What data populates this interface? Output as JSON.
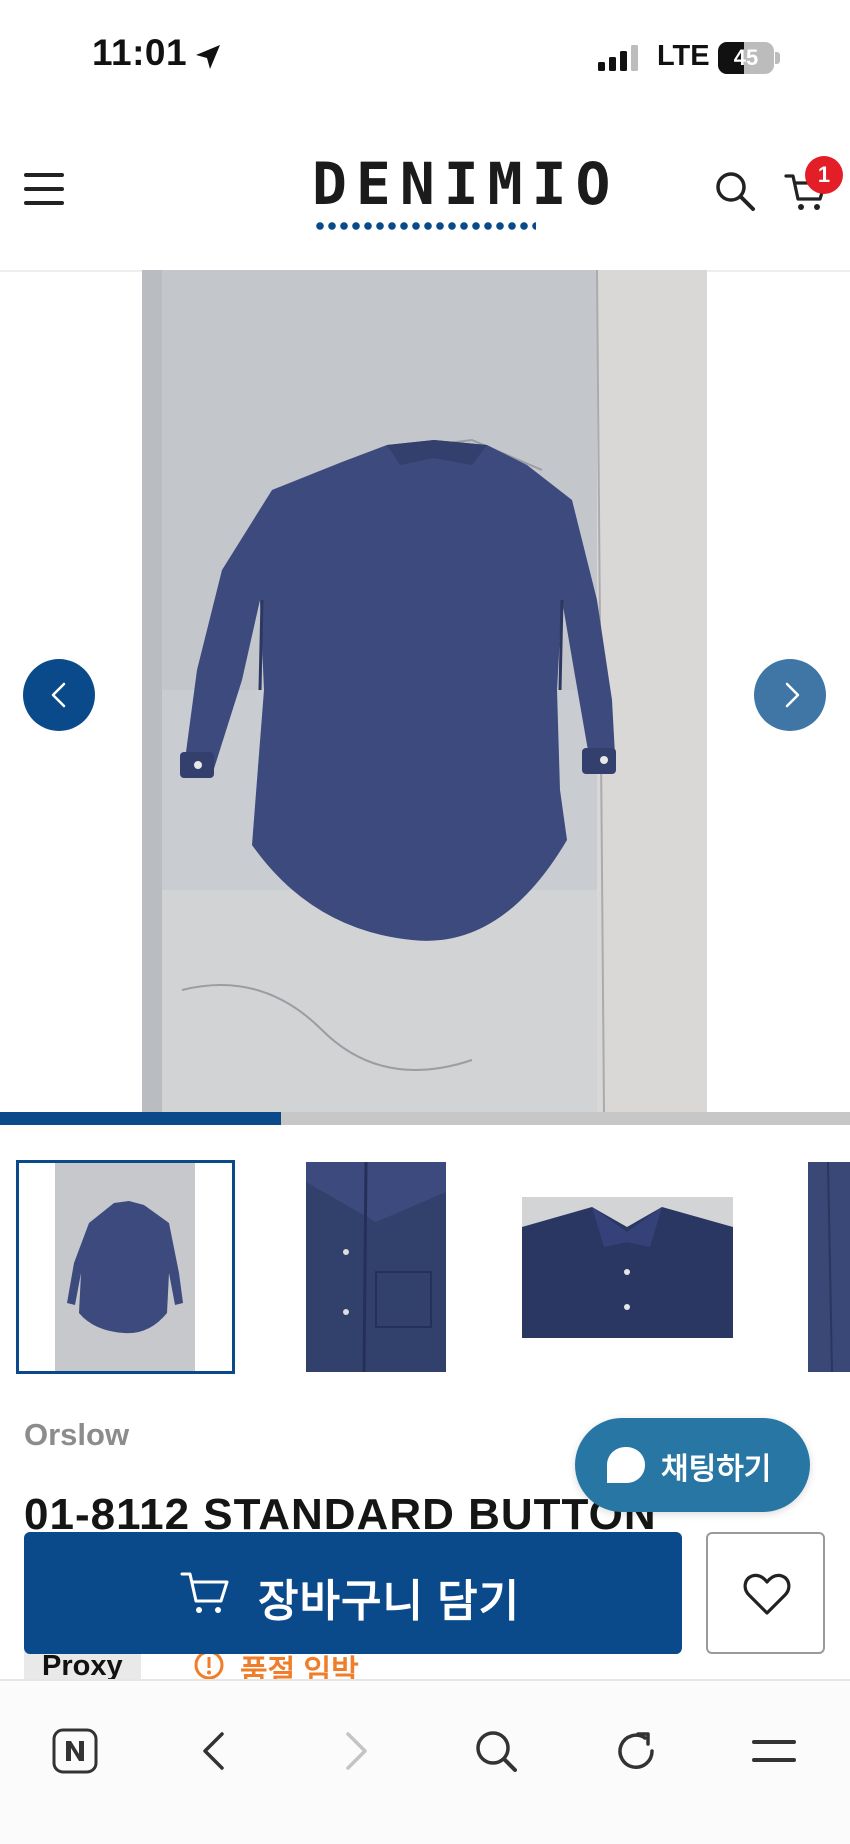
{
  "status_bar": {
    "time": "11:01",
    "carrier": "LTE",
    "battery": "45",
    "icons": [
      "location-arrow-icon",
      "signal-icon",
      "battery-icon"
    ]
  },
  "header": {
    "logo": "DENIMIO",
    "menu_icon": "hamburger-menu-icon",
    "search_icon": "search-icon",
    "cart_icon": "cart-icon",
    "cart_count": "1"
  },
  "gallery": {
    "image_count_visible": 4,
    "progress_fraction": 0.33,
    "prev_icon": "chevron-left-icon",
    "next_icon": "chevron-right-icon"
  },
  "product": {
    "brand": "Orslow",
    "title": "01-8112 STANDARD BUTTON",
    "proxy_label": "Proxy",
    "stock_status": "품절 임박",
    "stock_icon": "info-circle-icon"
  },
  "chat": {
    "label": "채팅하기",
    "icon": "chat-bubble-icon"
  },
  "actions": {
    "add_to_cart_label": "장바구니 담기",
    "add_to_cart_icon": "cart-icon",
    "wishlist_icon": "heart-icon"
  },
  "browser_bar": {
    "icons": [
      "naver-home-icon",
      "back-icon",
      "forward-icon",
      "search-icon",
      "reload-icon",
      "menu-icon"
    ]
  },
  "colors": {
    "brand_navy": "#0b4a8a",
    "chat_blue": "#2776a4",
    "badge_red": "#e41e26",
    "warning_orange": "#ef7d2a"
  }
}
